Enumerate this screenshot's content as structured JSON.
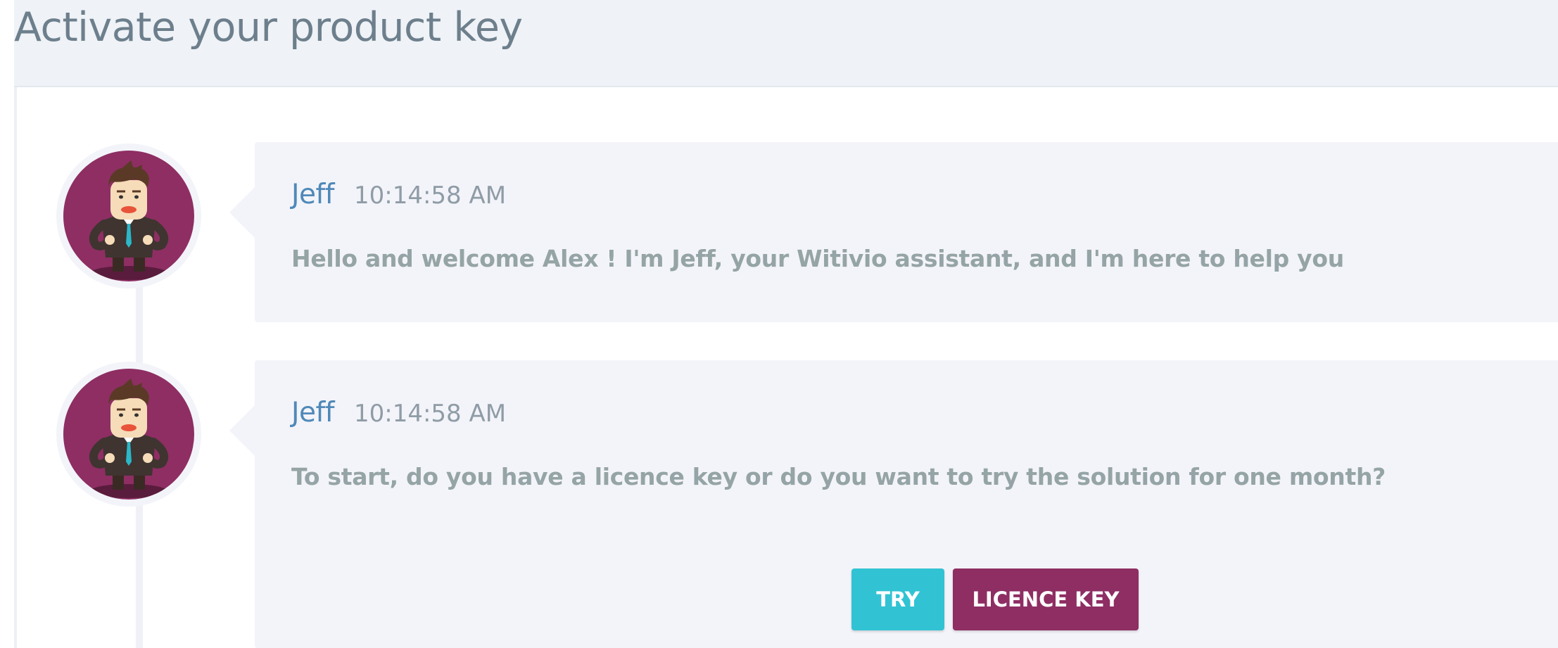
{
  "header": {
    "title": "Activate your product key"
  },
  "messages": [
    {
      "author": "Jeff",
      "time": "10:14:58 AM",
      "text": "Hello and welcome Alex ! I'm Jeff, your Witivio assistant, and I'm here to help you"
    },
    {
      "author": "Jeff",
      "time": "10:14:58 AM",
      "text": "To start, do you have a licence key or do you want to try the solution for one month?",
      "actions": [
        {
          "label": "TRY"
        },
        {
          "label": "LICENCE KEY"
        }
      ]
    }
  ],
  "icons": {
    "avatar": "assistant-avatar-icon"
  },
  "colors": {
    "accent_primary": "#8e2e63",
    "accent_secondary": "#31c3d4",
    "author_name": "#4f89b9",
    "message_text": "#95a4a6",
    "bubble_bg": "#f3f4f9",
    "header_bg": "#eff2f6"
  }
}
